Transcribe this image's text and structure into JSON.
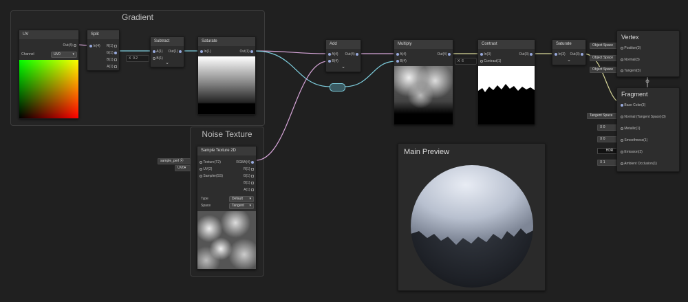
{
  "gradient_group": {
    "title": "Gradient"
  },
  "noise_group": {
    "title": "Noise Texture"
  },
  "uv_node": {
    "title": "UV",
    "out_label": "Out(4)",
    "channel_label": "Channel",
    "channel_value": "UV0"
  },
  "split_node": {
    "title": "Split",
    "in_label": "In(4)",
    "outs": [
      "R(1)",
      "G(1)",
      "B(1)",
      "A(1)"
    ]
  },
  "subtract_node": {
    "title": "Subtract",
    "a_label": "A(1)",
    "b_label": "B(1)",
    "out_label": "Out(1)",
    "b_field_axis": "X",
    "b_field_value": "0.2"
  },
  "saturate1_node": {
    "title": "Saturate",
    "in_label": "In(1)",
    "out_label": "Out(1)"
  },
  "sample_node": {
    "title": "Sample Texture 2D",
    "inputs": [
      "Texture(T2)",
      "UV(2)",
      "Sampler(SS)"
    ],
    "outputs": [
      "RGBA(4)",
      "R(1)",
      "G(1)",
      "B(1)",
      "A(1)"
    ],
    "type_label": "Type",
    "type_value": "Default",
    "space_label": "Space",
    "space_value": "Tangent",
    "ext_texture": "sample_perl",
    "ext_uv": "UV0"
  },
  "add_node": {
    "title": "Add",
    "a_label": "A(4)",
    "b_label": "B(4)",
    "out_label": "Out(4)"
  },
  "multiply_node": {
    "title": "Multiply",
    "a_label": "A(4)",
    "b_label": "B(4)",
    "out_label": "Out(4)"
  },
  "contrast_node": {
    "title": "Contrast",
    "in_label": "In(3)",
    "contrast_label": "Contrast(1)",
    "out_label": "Out(3)",
    "field_axis": "X",
    "field_value": "6"
  },
  "saturate2_node": {
    "title": "Saturate",
    "in_label": "In(3)",
    "out_label": "Out(3)"
  },
  "vertex_panel": {
    "title": "Vertex",
    "rows": [
      {
        "ext": "Object Space",
        "label": "Position(3)"
      },
      {
        "ext": "Object Space",
        "label": "Normal(3)"
      },
      {
        "ext": "Object Space",
        "label": "Tangent(3)"
      }
    ]
  },
  "fragment_panel": {
    "title": "Fragment",
    "rows": [
      {
        "ext": "",
        "label": "Base Color(3)"
      },
      {
        "ext": "Tangent Space",
        "label": "Normal (Tangent Space)(3)"
      },
      {
        "ext": "X  0",
        "label": "Metallic(1)"
      },
      {
        "ext": "X  0",
        "label": "Smoothness(1)"
      },
      {
        "ext": "HDR",
        "label": "Emission(3)"
      },
      {
        "ext": "X  1",
        "label": "Ambient Occlusion(1)"
      }
    ]
  },
  "main_preview": {
    "title": "Main Preview"
  },
  "colors": {
    "background": "#202020",
    "wire_blue": "#7fd0e0",
    "wire_pink": "#d7a6d9",
    "wire_yellow": "#d9d99a"
  }
}
